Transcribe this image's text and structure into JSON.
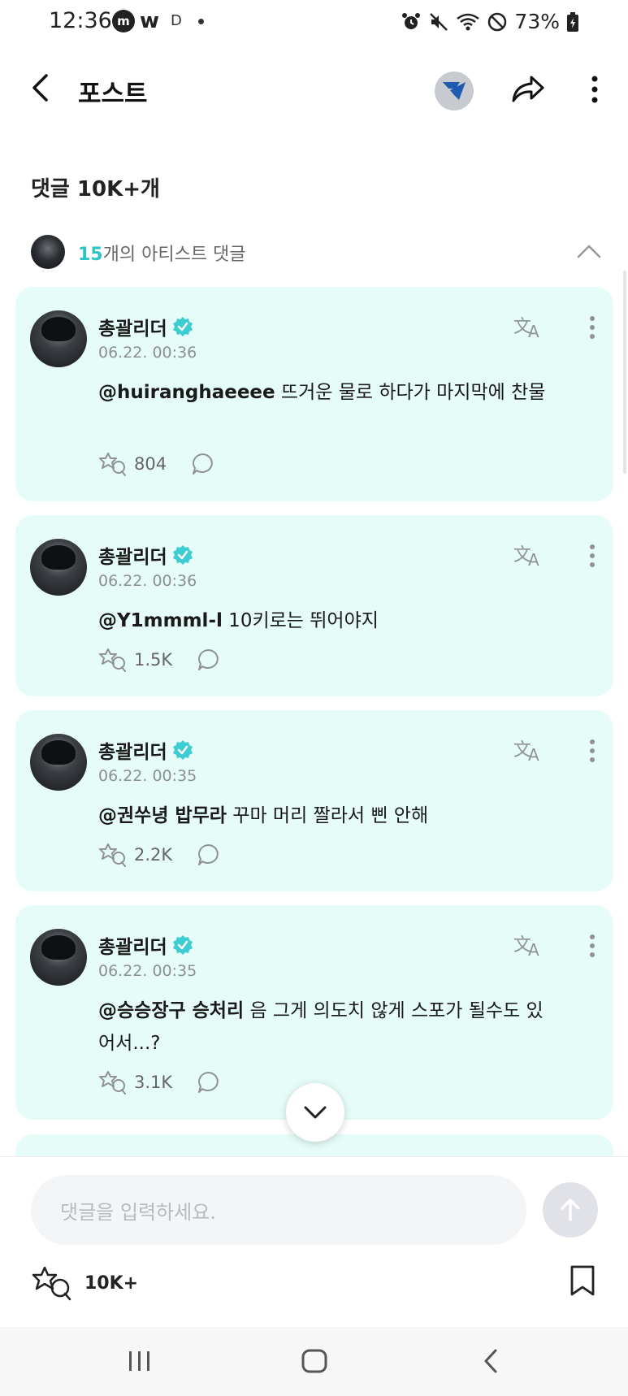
{
  "status_bar": {
    "time": "12:36",
    "app_m": "m",
    "app_w": "w",
    "app_d": "D",
    "battery": "73%"
  },
  "header": {
    "title": "포스트"
  },
  "comments_count": "댓글 10K+개",
  "artist_comments": {
    "count": "15",
    "label": "개의 아티스트 댓글"
  },
  "comments": [
    {
      "author": "총괄리더",
      "date": "06.22. 00:36",
      "mention": "@huiranghaeeee",
      "text": " 뜨거운 물로 하다가 마지막에 찬물",
      "likes": "804"
    },
    {
      "author": "총괄리더",
      "date": "06.22. 00:36",
      "mention": "@Y1mmml-l",
      "text": " 10키로는 뛰어야지",
      "likes": "1.5K"
    },
    {
      "author": "총괄리더",
      "date": "06.22. 00:35",
      "mention": "@권쑤녕 밥무라",
      "text": " 꾸마 머리 짤라서 삔 안해",
      "likes": "2.2K"
    },
    {
      "author": "총괄리더",
      "date": "06.22. 00:35",
      "mention": "@승승장구 승처리",
      "text": " 음 그게 의도치 않게 스포가 될수도 있어서...?",
      "likes": "3.1K"
    }
  ],
  "input": {
    "placeholder": "댓글을 입력하세요."
  },
  "footer": {
    "total_likes": "10K+"
  },
  "colors": {
    "card_bg": "#e5fcf8",
    "accent": "#2bc3c3",
    "verified": "#3ccdd2"
  }
}
